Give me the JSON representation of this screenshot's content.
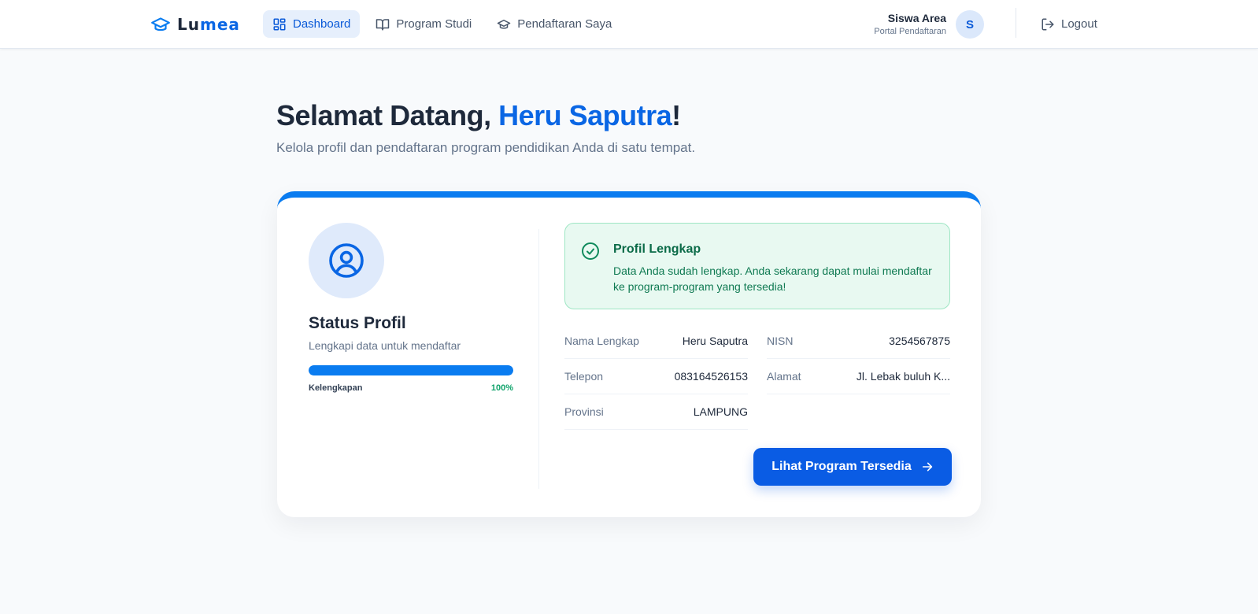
{
  "header": {
    "brand": {
      "prefix": "Lu",
      "accent": "mea",
      "icon": "graduation-cap-icon"
    },
    "nav": [
      {
        "label": "Dashboard",
        "icon": "dashboard-grid-icon",
        "active": true
      },
      {
        "label": "Program Studi",
        "icon": "book-icon",
        "active": false
      },
      {
        "label": "Pendaftaran Saya",
        "icon": "graduation-cap-icon",
        "active": false
      }
    ],
    "user": {
      "name": "Siswa Area",
      "subtitle": "Portal Pendaftaran",
      "initial": "S"
    },
    "logout_label": "Logout"
  },
  "hero": {
    "greeting": "Selamat Datang, ",
    "name": "Heru Saputra",
    "punct": "!",
    "subtitle": "Kelola profil dan pendaftaran program pendidikan Anda di satu tempat."
  },
  "profile_status": {
    "title": "Status Profil",
    "subtitle": "Lengkapi data untuk mendaftar",
    "progress_label": "Kelengkapan",
    "progress_value": "100%",
    "progress_fraction": 1.0
  },
  "alert": {
    "title": "Profil Lengkap",
    "text": "Data Anda sudah lengkap. Anda sekarang dapat mulai mendaftar ke program-program yang tersedia!"
  },
  "fields": [
    {
      "label": "Nama Lengkap",
      "value": "Heru Saputra"
    },
    {
      "label": "NISN",
      "value": "3254567875"
    },
    {
      "label": "Telepon",
      "value": "083164526153"
    },
    {
      "label": "Alamat",
      "value": "Jl. Lebak buluh K..."
    },
    {
      "label": "Provinsi",
      "value": "LAMPUNG"
    }
  ],
  "cta_label": "Lihat Program Tersedia",
  "colors": {
    "primary": "#0a66e4",
    "accent_bar": "#0a7cf0",
    "success": "#10a36b",
    "success_bg": "#e8f9f1"
  }
}
